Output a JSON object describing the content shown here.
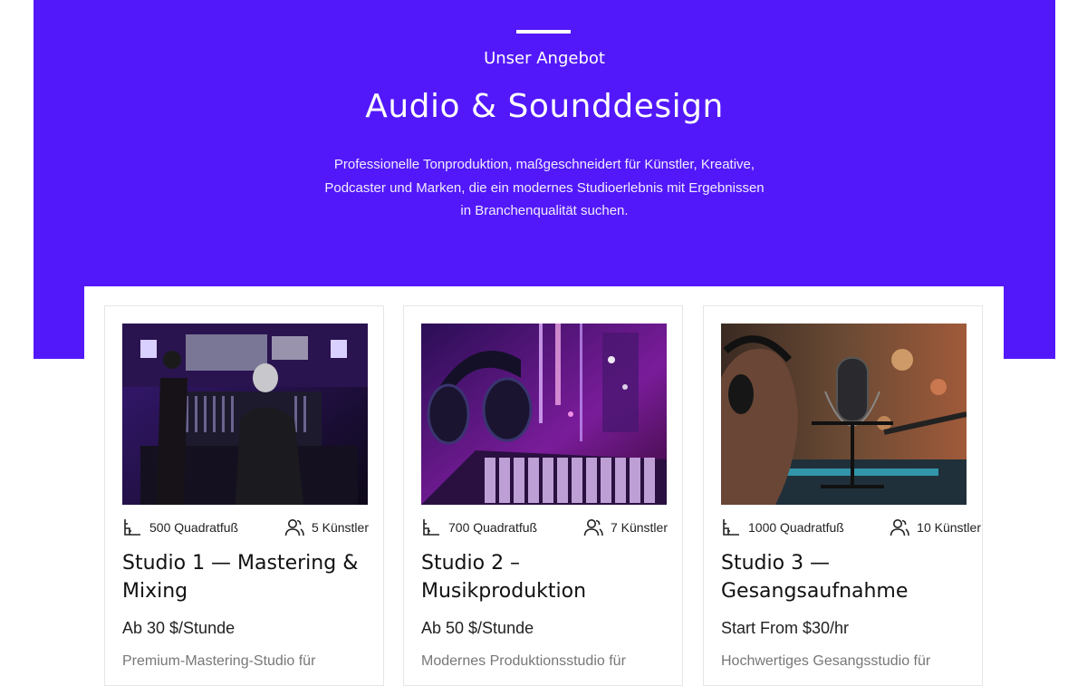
{
  "hero": {
    "eyebrow": "Unser Angebot",
    "title": "Audio & Sounddesign",
    "description": "Professionelle Tonproduktion, maßgeschneidert für Künstler, Kreative, Podcaster und Marken, die ein modernes Studioerlebnis mit Ergebnissen in Branchenqualität suchen.",
    "background_color": "#5218fa"
  },
  "studios": [
    {
      "area": "500 Quadratfuß",
      "artists": "5 Künstler",
      "title": "Studio 1 — Mastering & Mixing",
      "price": "Ab 30 $/Stunde",
      "description": "Premium-Mastering-Studio für",
      "image": "mixing-console-photo"
    },
    {
      "area": "700 Quadratfuß",
      "artists": "7 Künstler",
      "title": "Studio 2 – Musikproduktion",
      "price": "Ab 50 $/Stunde",
      "description": "Modernes Produktionsstudio für",
      "image": "headphones-keyboard-photo"
    },
    {
      "area": "1000 Quadratfuß",
      "artists": "10 Künstler",
      "title": "Studio 3 — Gesangsaufnahme",
      "price": "Start From $30/hr",
      "description": "Hochwertiges Gesangsstudio für",
      "image": "vocal-microphone-photo"
    }
  ],
  "icons": {
    "area": "ruler-icon",
    "artists": "people-icon"
  }
}
